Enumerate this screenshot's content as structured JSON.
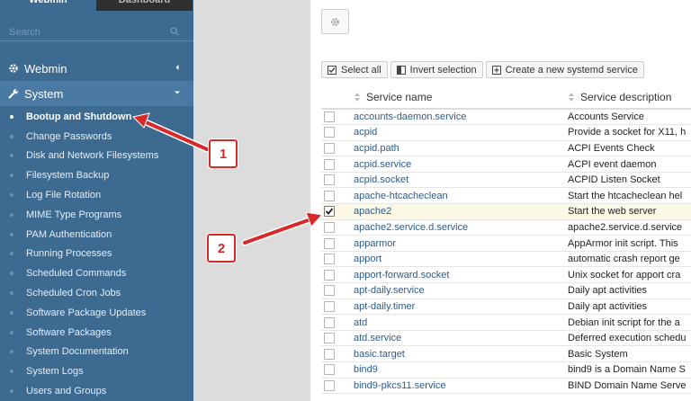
{
  "sidebar": {
    "tabs": [
      "Webmin",
      "Dashboard"
    ],
    "search_placeholder": "Search",
    "categories": [
      {
        "label": "Webmin",
        "expanded": false
      },
      {
        "label": "System",
        "expanded": true
      }
    ],
    "items": [
      "Bootup and Shutdown",
      "Change Passwords",
      "Disk and Network Filesystems",
      "Filesystem Backup",
      "Log File Rotation",
      "MIME Type Programs",
      "PAM Authentication",
      "Running Processes",
      "Scheduled Commands",
      "Scheduled Cron Jobs",
      "Software Package Updates",
      "Software Packages",
      "System Documentation",
      "System Logs",
      "Users and Groups"
    ],
    "active_item": "Bootup and Shutdown"
  },
  "toolbar": {
    "select_all": "Select all",
    "invert_selection": "Invert selection",
    "create_service": "Create a new systemd service"
  },
  "table": {
    "headers": {
      "name": "Service name",
      "description": "Service description"
    },
    "rows": [
      {
        "name": "accounts-daemon.service",
        "description": "Accounts Service",
        "checked": false
      },
      {
        "name": "acpid",
        "description": "Provide a socket for X11, h",
        "checked": false
      },
      {
        "name": "acpid.path",
        "description": "ACPI Events Check",
        "checked": false
      },
      {
        "name": "acpid.service",
        "description": "ACPI event daemon",
        "checked": false
      },
      {
        "name": "acpid.socket",
        "description": "ACPID Listen Socket",
        "checked": false
      },
      {
        "name": "apache-htcacheclean",
        "description": "Start the htcacheclean hel",
        "checked": false
      },
      {
        "name": "apache2",
        "description": "Start the web server",
        "checked": true
      },
      {
        "name": "apache2.service.d.service",
        "description": "apache2.service.d.service",
        "checked": false
      },
      {
        "name": "apparmor",
        "description": "AppArmor init script. This",
        "checked": false
      },
      {
        "name": "apport",
        "description": "automatic crash report ge",
        "checked": false
      },
      {
        "name": "apport-forward.socket",
        "description": "Unix socket for apport cra",
        "checked": false
      },
      {
        "name": "apt-daily.service",
        "description": "Daily apt activities",
        "checked": false
      },
      {
        "name": "apt-daily.timer",
        "description": "Daily apt activities",
        "checked": false
      },
      {
        "name": "atd",
        "description": "Debian init script for the a",
        "checked": false
      },
      {
        "name": "atd.service",
        "description": "Deferred execution schedu",
        "checked": false
      },
      {
        "name": "basic.target",
        "description": "Basic System",
        "checked": false
      },
      {
        "name": "bind9",
        "description": "bind9 is a Domain Name S",
        "checked": false
      },
      {
        "name": "bind9-pkcs11.service",
        "description": "BIND Domain Name Serve",
        "checked": false
      }
    ]
  },
  "annotations": {
    "callout_1": "1",
    "callout_2": "2",
    "color": "#d62a2a"
  }
}
